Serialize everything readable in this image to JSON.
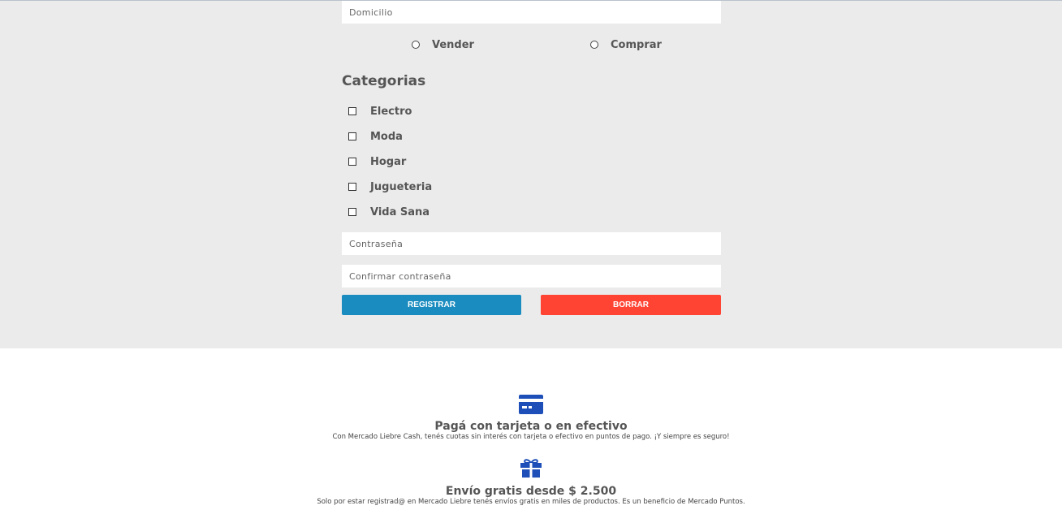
{
  "form": {
    "address_placeholder": "Domicilio",
    "radio_options": [
      {
        "label": "Vender"
      },
      {
        "label": "Comprar"
      }
    ],
    "categories_title": "Categorias",
    "categories": [
      {
        "label": "Electro"
      },
      {
        "label": "Moda"
      },
      {
        "label": "Hogar"
      },
      {
        "label": "Jugueteria"
      },
      {
        "label": "Vida Sana"
      }
    ],
    "password_placeholder": "Contraseña",
    "confirm_password_placeholder": "Confirmar contraseña",
    "register_label": "REGISTRAR",
    "clear_label": "BORRAR",
    "colors": {
      "register": "#1a8cbf",
      "clear": "#ff4433",
      "background": "#ebebeb"
    }
  },
  "benefits": [
    {
      "icon": "credit-card-icon",
      "title": "Pagá con tarjeta o en efectivo",
      "description": "Con Mercado Liebre Cash, tenés cuotas sin interés con tarjeta o efectivo en puntos de pago. ¡Y siempre es seguro!"
    },
    {
      "icon": "gift-icon",
      "title": "Envío gratis desde $ 2.500",
      "description": "Solo por estar registrad@ en Mercado Liebre tenés envíos gratis en miles de productos. Es un beneficio de Mercado Puntos."
    }
  ],
  "icon_color": "#1e4fb8"
}
